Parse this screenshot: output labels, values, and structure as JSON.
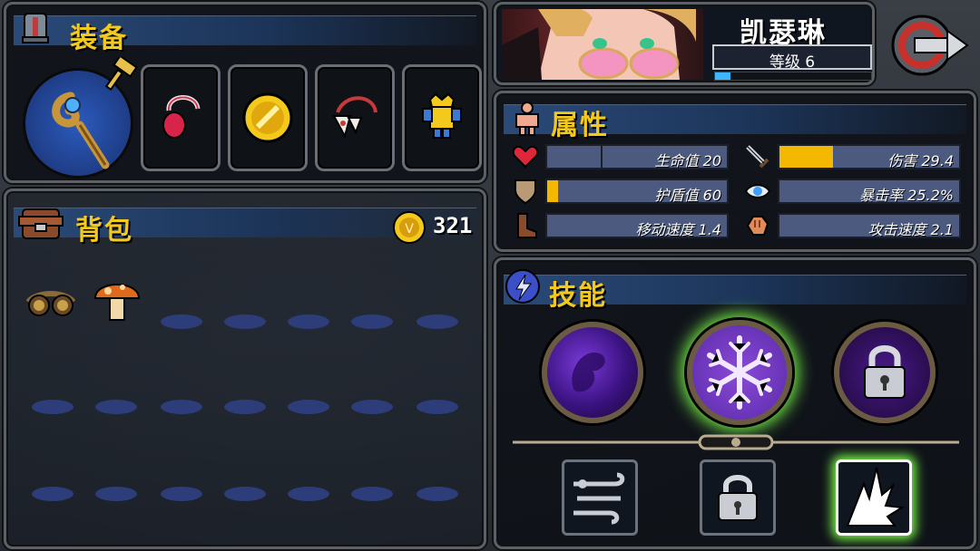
{
  "equipment": {
    "title": "装备"
  },
  "backpack": {
    "title": "背包",
    "coins": "321"
  },
  "character": {
    "name": "凯瑟琳",
    "level_label": "等级 6",
    "xp_progress": 0.1
  },
  "attributes": {
    "title": "属性",
    "stats": [
      {
        "key": "hp",
        "text": "生命值 20",
        "fill": 0.3,
        "color": "#4b5a7e",
        "icon": "heart-icon"
      },
      {
        "key": "damage",
        "text": "伤害 29.4",
        "fill": 0.3,
        "color": "#f5b800",
        "icon": "sword-icon"
      },
      {
        "key": "shield",
        "text": "护盾值 60",
        "fill": 0.06,
        "color": "#f5b800",
        "icon": "shield-icon"
      },
      {
        "key": "crit",
        "text": "暴击率 25.2%",
        "fill": 0.0,
        "color": "#f5b800",
        "icon": "eye-icon"
      },
      {
        "key": "speed",
        "text": "移动速度 1.4",
        "fill": 0.0,
        "color": "#f5b800",
        "icon": "boot-icon"
      },
      {
        "key": "atkspeed",
        "text": "攻击速度 2.1",
        "fill": 0.0,
        "color": "#f5b800",
        "icon": "fist-icon"
      }
    ]
  },
  "skills": {
    "title": "技能"
  },
  "colors": {
    "accent_gold": "#f3c91c",
    "panel_header": "#2a4a78",
    "selected_glow": "#7dff4a"
  }
}
